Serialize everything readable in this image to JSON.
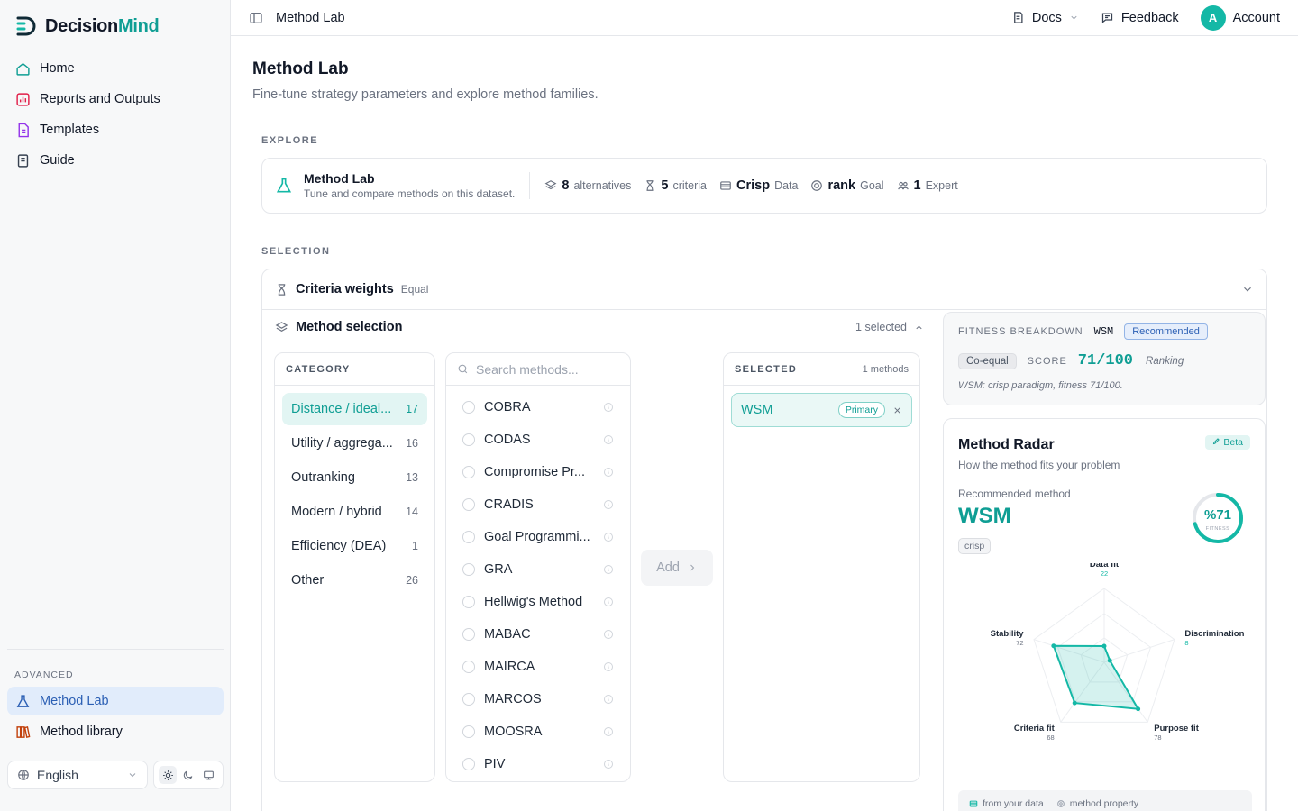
{
  "app": {
    "name_part1": "Decision",
    "name_part2": "Mind"
  },
  "sidebar": {
    "items": [
      {
        "label": "Home",
        "icon": "home-icon"
      },
      {
        "label": "Reports and Outputs",
        "icon": "bar-chart-icon"
      },
      {
        "label": "Templates",
        "icon": "document-template-icon"
      },
      {
        "label": "Guide",
        "icon": "book-icon"
      }
    ],
    "advanced_label": "ADVANCED",
    "advanced_items": [
      {
        "label": "Method Lab",
        "icon": "flask-icon",
        "active": true
      },
      {
        "label": "Method library",
        "icon": "library-icon"
      }
    ],
    "language": "English"
  },
  "topbar": {
    "crumb": "Method Lab",
    "docs": "Docs",
    "feedback": "Feedback",
    "avatar_letter": "A",
    "account": "Account"
  },
  "page": {
    "title": "Method Lab",
    "subtitle": "Fine-tune strategy parameters and explore method families."
  },
  "explore": {
    "section_label": "EXPLORE",
    "title": "Method Lab",
    "subtitle": "Tune and compare methods on this dataset.",
    "stats": [
      {
        "value": "8",
        "label": "alternatives"
      },
      {
        "value": "5",
        "label": "criteria"
      },
      {
        "value": "Crisp",
        "label": "Data"
      },
      {
        "value": "rank",
        "label": "Goal"
      },
      {
        "value": "1",
        "label": "Expert"
      }
    ]
  },
  "selection": {
    "section_label": "SELECTION",
    "criteria_weights": {
      "title": "Criteria weights",
      "value": "Equal"
    },
    "method_selection": {
      "title": "Method selection",
      "count": "1 selected"
    },
    "category_header": "CATEGORY",
    "categories": [
      {
        "label": "Distance / ideal...",
        "count": "17",
        "active": true
      },
      {
        "label": "Utility / aggrega...",
        "count": "16"
      },
      {
        "label": "Outranking",
        "count": "13"
      },
      {
        "label": "Modern / hybrid",
        "count": "14"
      },
      {
        "label": "Efficiency (DEA)",
        "count": "1"
      },
      {
        "label": "Other",
        "count": "26"
      }
    ],
    "search_placeholder": "Search methods...",
    "methods": [
      "COBRA",
      "CODAS",
      "Compromise Pr...",
      "CRADIS",
      "Goal Programmi...",
      "GRA",
      "Hellwig's Method",
      "MABAC",
      "MAIRCA",
      "MARCOS",
      "MOOSRA",
      "PIV"
    ],
    "add_label": "Add",
    "selected_header": "SELECTED",
    "selected_count": "1 methods",
    "selected": [
      {
        "label": "WSM",
        "badge": "Primary"
      }
    ]
  },
  "fitness": {
    "label": "FITNESS BREAKDOWN",
    "method": "WSM",
    "badge": "Recommended",
    "tag": "Co-equal",
    "score_label": "SCORE",
    "score": "71/100",
    "type": "Ranking",
    "note": "WSM: crisp paradigm, fitness 71/100."
  },
  "radar": {
    "title": "Method Radar",
    "subtitle": "How the method fits your problem",
    "beta": "Beta",
    "rec_label": "Recommended method",
    "rec_value": "WSM",
    "rec_tag": "crisp",
    "ring_value": "%71",
    "ring_label": "FITNESS",
    "ring_fraction": 0.71,
    "axes": [
      {
        "label": "Data fit",
        "value": 22
      },
      {
        "label": "Discrimination",
        "value": 8
      },
      {
        "label": "Purpose fit",
        "value": 78
      },
      {
        "label": "Criteria fit",
        "value": 68
      },
      {
        "label": "Stability",
        "value": 72
      }
    ],
    "legend": [
      "from your data",
      "method property"
    ],
    "accent": "#14b8a6"
  }
}
